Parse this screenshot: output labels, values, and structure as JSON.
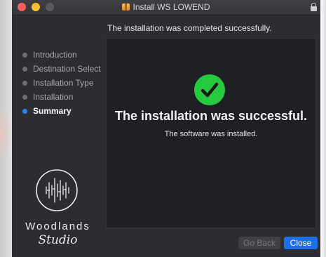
{
  "window": {
    "title": "Install WS LOWEND"
  },
  "header": {
    "subtitle": "The installation was completed successfully."
  },
  "sidebar": {
    "steps": [
      {
        "label": "Introduction",
        "active": false
      },
      {
        "label": "Destination Select",
        "active": false
      },
      {
        "label": "Installation Type",
        "active": false
      },
      {
        "label": "Installation",
        "active": false
      },
      {
        "label": "Summary",
        "active": true
      }
    ]
  },
  "brand": {
    "line1": "Woodlands",
    "line2": "Studio"
  },
  "main": {
    "headline": "The installation was successful.",
    "detail": "The software was installed."
  },
  "buttons": {
    "back_label": "Go Back",
    "close_label": "Close"
  },
  "colors": {
    "accent": "#1c6fe6",
    "success": "#27c93f",
    "active_step_dot": "#2a86f4"
  },
  "icons": {
    "check": "check-circle-icon",
    "package": "package-icon",
    "lock": "lock-icon"
  }
}
